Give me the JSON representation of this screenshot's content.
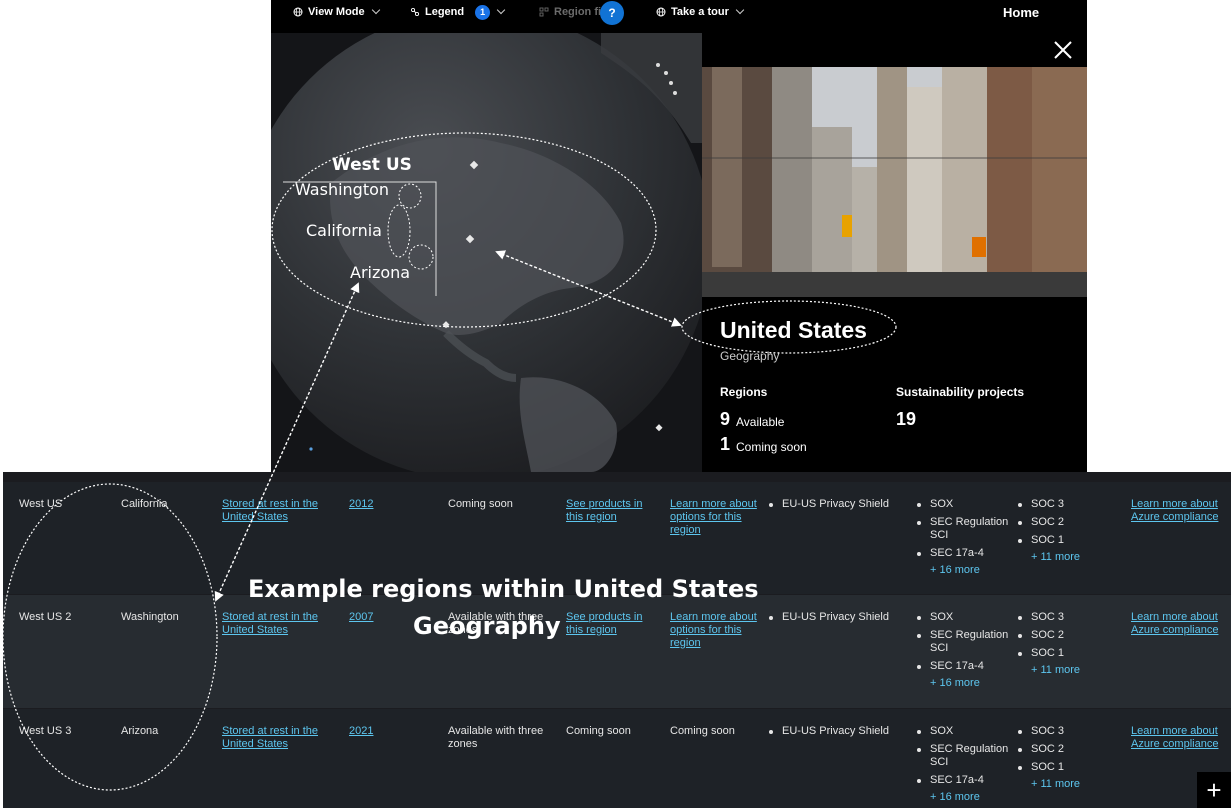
{
  "topbar": {
    "view_mode": "View Mode",
    "legend": "Legend",
    "legend_badge": "1",
    "region_filter": "Region filt",
    "help_badge": "?",
    "tour": "Take a tour",
    "home": "Home"
  },
  "map_annotations": {
    "group_label": "West US",
    "states": [
      "Washington",
      "California",
      "Arizona"
    ]
  },
  "panel": {
    "title": "United States",
    "subtitle": "Geography",
    "regions_label": "Regions",
    "available_count": "9",
    "available_text": "Available",
    "coming_count": "1",
    "coming_text": "Coming soon",
    "sustain_label": "Sustainability projects",
    "sustain_count": "19"
  },
  "table": {
    "rows": [
      {
        "region": "West US",
        "state": "California",
        "data_residency": "Stored at rest in the United States",
        "year": "2012",
        "az": "Coming soon",
        "products": "See products in this region",
        "options": "Learn more about options for this region",
        "privacy": "EU-US Privacy Shield",
        "compliance_a": [
          "SOX",
          "SEC Regulation SCI",
          "SEC 17a-4"
        ],
        "more_a": "+ 16 more",
        "compliance_b": [
          "SOC 3",
          "SOC 2",
          "SOC 1"
        ],
        "more_b": "+ 11 more",
        "azure": "Learn more about Azure compliance"
      },
      {
        "region": "West US 2",
        "state": "Washington",
        "data_residency": "Stored at rest in the United States",
        "year": "2007",
        "az": "Available with three zones",
        "products": "See products in this region",
        "options": "Learn more about options for this region",
        "privacy": "EU-US Privacy Shield",
        "compliance_a": [
          "SOX",
          "SEC Regulation SCI",
          "SEC 17a-4"
        ],
        "more_a": "+ 16 more",
        "compliance_b": [
          "SOC 3",
          "SOC 2",
          "SOC 1"
        ],
        "more_b": "+ 11 more",
        "azure": "Learn more about Azure compliance"
      },
      {
        "region": "West US 3",
        "state": "Arizona",
        "data_residency": "Stored at rest in the United States",
        "year": "2021",
        "az": "Available with three zones",
        "products": "Coming soon",
        "options": "Coming soon",
        "privacy": "EU-US Privacy Shield",
        "compliance_a": [
          "SOX",
          "SEC Regulation SCI",
          "SEC 17a-4"
        ],
        "more_a": "+ 16 more",
        "compliance_b": [
          "SOC 3",
          "SOC 2",
          "SOC 1"
        ],
        "more_b": "+ 11 more",
        "azure": "Learn more about Azure compliance"
      }
    ],
    "expand_label": "+"
  },
  "caption": {
    "line1": "Example regions within United States",
    "line2": "Geography"
  }
}
